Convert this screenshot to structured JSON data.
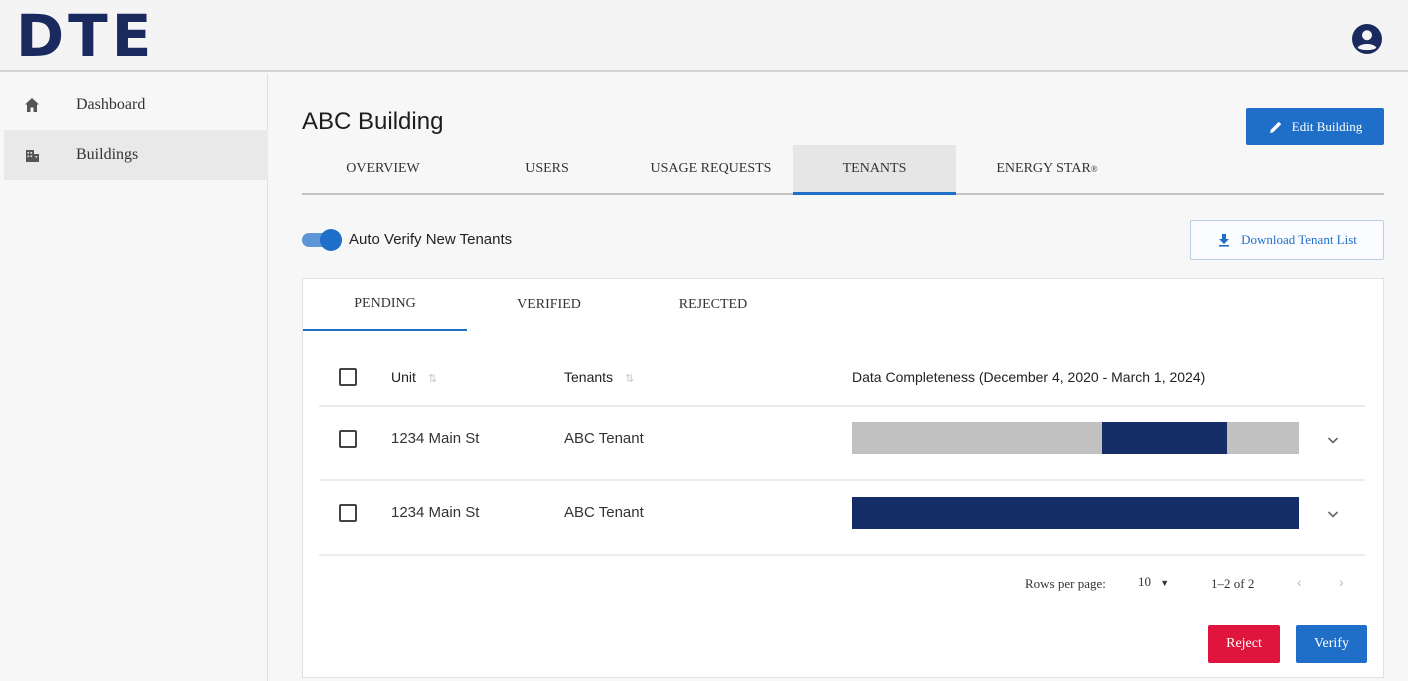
{
  "header": {
    "logo": "DTE",
    "avatar_icon": "account-circle-icon"
  },
  "sidebar": {
    "items": [
      {
        "label": "Dashboard",
        "icon": "home-icon",
        "active": false
      },
      {
        "label": "Buildings",
        "icon": "building-icon",
        "active": true
      }
    ]
  },
  "page": {
    "title": "ABC Building",
    "edit_label": "Edit Building",
    "tabs": [
      {
        "label": "OVERVIEW"
      },
      {
        "label": "USERS"
      },
      {
        "label": "USAGE REQUESTS"
      },
      {
        "label": "TENANTS"
      },
      {
        "label": "ENERGY STAR",
        "mark": "®"
      }
    ],
    "active_tab": "TENANTS",
    "auto_verify": {
      "label": "Auto Verify New Tenants",
      "enabled": true
    },
    "download_label": "Download Tenant List"
  },
  "tenants": {
    "subtabs": [
      {
        "label": "PENDING"
      },
      {
        "label": "VERIFIED"
      },
      {
        "label": "REJECTED"
      }
    ],
    "active_subtab": "PENDING",
    "columns": {
      "unit": "Unit",
      "tenants": "Tenants",
      "completeness": "Data Completeness (December 4, 2020 - March 1, 2024)"
    },
    "rows": [
      {
        "unit": "1234 Main St",
        "tenant": "ABC Tenant",
        "completeness": {
          "filled_from": 0.56,
          "filled_to": 0.84
        }
      },
      {
        "unit": "1234 Main St",
        "tenant": "ABC Tenant",
        "completeness": {
          "filled_from": 0.0,
          "filled_to": 1.0
        }
      }
    ],
    "pagination": {
      "rows_per_page_label": "Rows per page:",
      "rows_per_page": "10",
      "range": "1–2 of 2"
    },
    "actions": {
      "reject": "Reject",
      "verify": "Verify"
    }
  },
  "colors": {
    "primary": "#1f6fc9",
    "navy": "#142d66",
    "danger": "#e0153d"
  }
}
